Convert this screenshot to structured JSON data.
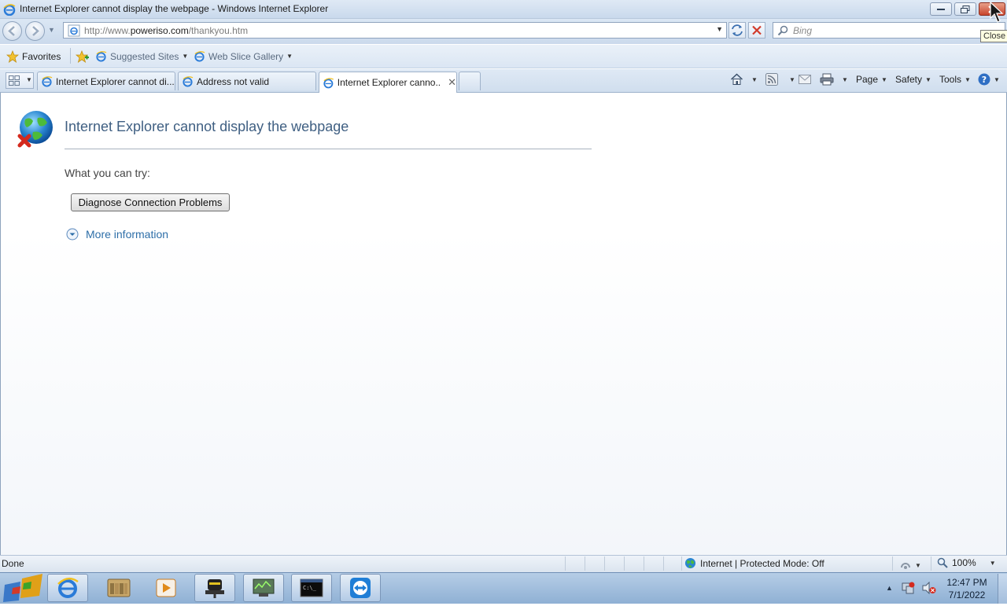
{
  "window": {
    "title": "Internet Explorer cannot display the webpage - Windows Internet Explorer",
    "close_tooltip": "Close"
  },
  "address_bar": {
    "url_prefix": "http://www.",
    "url_domain": "poweriso.com",
    "url_path": "/thankyou.htm"
  },
  "search": {
    "placeholder": "Bing"
  },
  "favorites_bar": {
    "favorites_label": "Favorites",
    "suggested_sites_label": "Suggested Sites",
    "web_slice_label": "Web Slice Gallery"
  },
  "tabs": [
    {
      "label": "Internet Explorer cannot di...",
      "active": false
    },
    {
      "label": "Address not valid",
      "active": false
    },
    {
      "label": "Internet Explorer canno...",
      "active": true
    }
  ],
  "command_bar": {
    "page_label": "Page",
    "safety_label": "Safety",
    "tools_label": "Tools"
  },
  "content": {
    "heading": "Internet Explorer cannot display the webpage",
    "try_text": "What you can try:",
    "diagnose_button": "Diagnose Connection Problems",
    "more_info": "More information"
  },
  "status_bar": {
    "status": "Done",
    "zone": "Internet | Protected Mode: Off",
    "zoom": "100%"
  },
  "taskbar": {
    "time": "12:47 PM",
    "date": "7/1/2022"
  },
  "colors": {
    "heading": "#3f5f82",
    "link": "#2d6ea8",
    "close_button": "#c9452c",
    "tooltip_bg": "#ffffe1"
  }
}
